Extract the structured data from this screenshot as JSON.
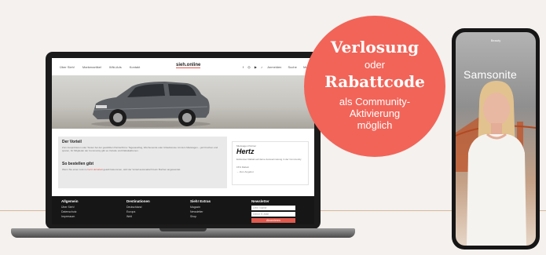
{
  "laptop": {
    "nav": {
      "items": [
        "Über Sieh!",
        "Markenartikel",
        "Wiki-Ads",
        "Kontakt"
      ],
      "logo": "sieh.online",
      "socials": "f ◎ ▶ ♪",
      "right_links": [
        "Anmelden",
        "Suche",
        "Menü"
      ]
    },
    "hero_alt": "",
    "content": {
      "heading_1": "Der Vorteil",
      "para_1": "Zum Ausprobieren oder Testen bei der gewählten Partnerfirma: Tagesausflug, Wochenende oder Urlaubsreise mit dem Mietwagen – jetzt buchen und sparen, für Mitglieder der Community gibt es Vorteile und Rabattaktionen.",
      "heading_2": "So bestellen gibt",
      "para_2": "Wenn Sie einen Link zu ",
      "para_2_link": "hertz.de/rabatt",
      "para_2_rest": " geteilt bekommen, wird der Vorteil automatisch beim Buchen angewendet."
    },
    "card": {
      "label": "Mietwagen Partner",
      "brand": "Hertz",
      "desc": "Exklusiver Rabatt auf deine Autovermietung in der Community",
      "highlight": "15% Rabatt",
      "link": "→ Zum Angebot"
    },
    "footer": {
      "columns": [
        {
          "title": "Allgemein",
          "items": [
            "Über Sieh!",
            "Datenschutz",
            "Impressum"
          ]
        },
        {
          "title": "Destinationen",
          "items": [
            "Deutschland",
            "Europa",
            "Welt"
          ]
        },
        {
          "title": "Sieh! Extras",
          "items": [
            "Magazin",
            "Newsletter",
            "Shop"
          ]
        }
      ],
      "newsletter": {
        "title": "Newsletter",
        "name_placeholder": "Dein Name",
        "email_placeholder": "Deine E-Mail",
        "button": "Abonnieren"
      }
    }
  },
  "phone": {
    "top": "Beauty",
    "brand": "Samsonite"
  },
  "badge": {
    "line1": "Verlosung",
    "line2": "oder",
    "line3": "Rabattcode",
    "line4": "als Community-",
    "line5": "Aktivierung",
    "line6": "möglich"
  },
  "colors": {
    "badge": "#f26458",
    "background": "#f4f1ee",
    "divider": "#d9b79a",
    "footer": "#161616"
  }
}
